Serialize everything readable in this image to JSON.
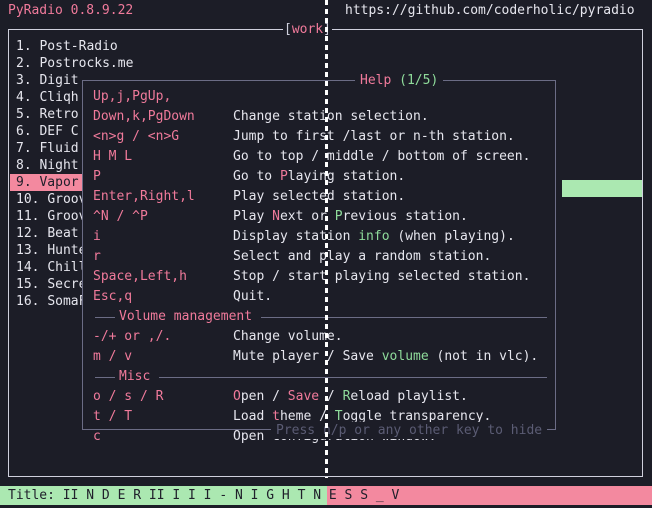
{
  "app": {
    "title": "PyRadio 0.8.9.22",
    "repo_url": "https://github.com/coderholic/pyradio",
    "playlist_label": "work",
    "playlist_open_bracket": "[",
    "playlist_close_bracket": "]"
  },
  "colors": {
    "background": "#1c1d27",
    "accent_pink": "#f07a9b",
    "selection_pink": "#f3899f",
    "accent_green": "#8fdc9b",
    "playing_green": "#abe8b1",
    "foreground": "#e6e6ee",
    "border": "#cfd0dd",
    "dialog_border": "#6b6c85",
    "muted": "#5b5c74"
  },
  "stations": [
    {
      "index": "1.",
      "name": "Post-Radio",
      "selected": false
    },
    {
      "index": "2.",
      "name": "Postrocks.me",
      "selected": false
    },
    {
      "index": "3.",
      "name": "Digit",
      "selected": false
    },
    {
      "index": "4.",
      "name": "Cliqh",
      "selected": false
    },
    {
      "index": "5.",
      "name": "Retro",
      "selected": false
    },
    {
      "index": "6.",
      "name": "DEF C",
      "selected": false
    },
    {
      "index": "7.",
      "name": "Fluid",
      "selected": false
    },
    {
      "index": "8.",
      "name": "Night",
      "selected": false
    },
    {
      "index": "9.",
      "name": "Vapor",
      "selected": true
    },
    {
      "index": "10.",
      "name": "Groov",
      "selected": false
    },
    {
      "index": "11.",
      "name": "Groov",
      "selected": false
    },
    {
      "index": "12.",
      "name": "Beat",
      "selected": false
    },
    {
      "index": "13.",
      "name": "Hunte",
      "selected": false
    },
    {
      "index": "14.",
      "name": "Chill",
      "selected": false
    },
    {
      "index": "15.",
      "name": "Secre",
      "selected": false
    },
    {
      "index": "16.",
      "name": "SomaF",
      "selected": false
    }
  ],
  "help": {
    "title_word": "Help ",
    "title_page": "(1/5)",
    "footer": "Press n/p or any other key to hide",
    "rows": [
      {
        "keys": "Up,j,PgUp,",
        "desc": ""
      },
      {
        "keys": "Down,k,PgDown",
        "desc": "Change station selection."
      },
      {
        "keys": "<n>g / <n>G",
        "desc": "Jump to first /last or n-th station."
      },
      {
        "keys": "H M L",
        "desc": "Go to top / middle / bottom of screen."
      },
      {
        "keys": "P",
        "desc": "Go to Playing station."
      },
      {
        "keys": "Enter,Right,l",
        "desc": "Play selected station."
      },
      {
        "keys": "^N / ^P",
        "desc": "Play Next or Previous station."
      },
      {
        "keys": "i",
        "desc": "Display station info (when playing)."
      },
      {
        "keys": "r",
        "desc": "Select and play a random station."
      },
      {
        "keys": "Space,Left,h",
        "desc": "Stop / start playing selected station."
      },
      {
        "keys": "Esc,q",
        "desc": "Quit."
      }
    ],
    "section_volume": {
      "label": "Volume management",
      "rows": [
        {
          "keys": "-/+ or ,/.",
          "desc": "Change volume."
        },
        {
          "keys": "m / v",
          "desc": "Mute player / Save volume (not in vlc)."
        }
      ]
    },
    "section_misc": {
      "label": "Misc",
      "rows": [
        {
          "keys": "o / s / R",
          "desc": "Open / Save / Reload playlist."
        },
        {
          "keys": "t / T",
          "desc": "Load theme / Toggle transparency."
        },
        {
          "keys": "c",
          "desc": "Open Configuration window."
        }
      ]
    }
  },
  "status": {
    "label": "Title: ",
    "value": "II N D E R II I I I - N I G H T N E S S _ V",
    "full": "Title: II N D E R II I I I - N I G H T N E S S _ V"
  }
}
